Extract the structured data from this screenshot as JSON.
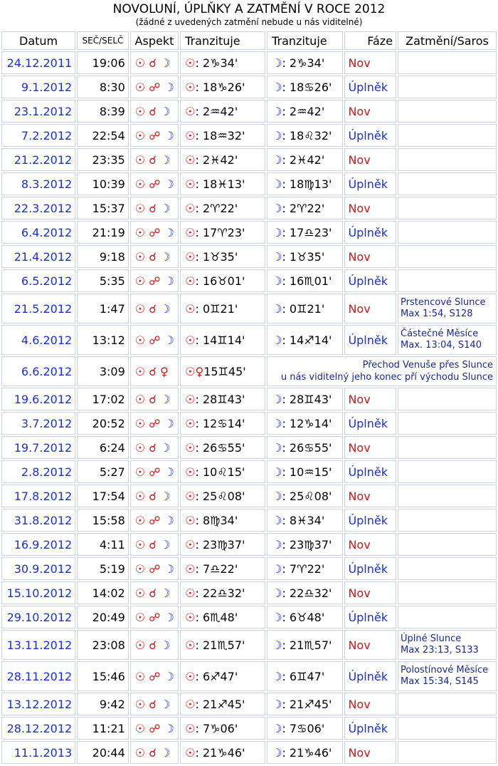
{
  "header": {
    "title": "NOVOLUNÍ, ÚPLŇKY A ZATMĚNÍ V ROCE 2012",
    "subtitle": "(žádné z uvedených zatmění nebude u nás viditelné)"
  },
  "columns": {
    "date": "Datum",
    "time": "SEČ/SELČ",
    "aspect": "Aspekt",
    "transit1": "Tranzituje",
    "transit2": "Tranzituje",
    "phase": "Fáze",
    "eclipse": "Zatmění/Saros"
  },
  "symbols": {
    "sun": "☉",
    "moon": "☽",
    "venus": "♀",
    "conj": "☌",
    "opp": "☍"
  },
  "rows": [
    {
      "date": "24.12.2011",
      "time": "19:06",
      "aspect": "☉ ☌ ☽",
      "sun": "☉: 2♑34'",
      "moon": "☽: 2♑34'",
      "phase": "Nov",
      "eclipse": ""
    },
    {
      "date": "9.1.2012",
      "time": "8:30",
      "aspect": "☉ ☍ ☽",
      "sun": "☉: 18♑26'",
      "moon": "☽: 18♋26'",
      "phase": "Úplněk",
      "eclipse": ""
    },
    {
      "date": "23.1.2012",
      "time": "8:39",
      "aspect": "☉ ☌ ☽",
      "sun": "☉: 2♒42'",
      "moon": "☽: 2♒42'",
      "phase": "Nov",
      "eclipse": ""
    },
    {
      "date": "7.2.2012",
      "time": "22:54",
      "aspect": "☉ ☍ ☽",
      "sun": "☉: 18♒32'",
      "moon": "☽: 18♌32'",
      "phase": "Úplněk",
      "eclipse": ""
    },
    {
      "date": "21.2.2012",
      "time": "23:35",
      "aspect": "☉ ☌ ☽",
      "sun": "☉: 2♓42'",
      "moon": "☽: 2♓42'",
      "phase": "Nov",
      "eclipse": ""
    },
    {
      "date": "8.3.2012",
      "time": "10:39",
      "aspect": "☉ ☍ ☽",
      "sun": "☉: 18♓13'",
      "moon": "☽: 18♍13'",
      "phase": "Úplněk",
      "eclipse": ""
    },
    {
      "date": "22.3.2012",
      "time": "15:37",
      "aspect": "☉ ☌ ☽",
      "sun": "☉: 2♈22'",
      "moon": "☽: 2♈22'",
      "phase": "Nov",
      "eclipse": ""
    },
    {
      "date": "6.4.2012",
      "time": "21:19",
      "aspect": "☉ ☍ ☽",
      "sun": "☉: 17♈23'",
      "moon": "☽: 17♎23'",
      "phase": "Úplněk",
      "eclipse": ""
    },
    {
      "date": "21.4.2012",
      "time": "9:18",
      "aspect": "☉ ☌ ☽",
      "sun": "☉: 1♉35'",
      "moon": "☽: 1♉35'",
      "phase": "Nov",
      "eclipse": ""
    },
    {
      "date": "6.5.2012",
      "time": "5:35",
      "aspect": "☉ ☍ ☽",
      "sun": "☉: 16♉01'",
      "moon": "☽: 16♏01'",
      "phase": "Úplněk",
      "eclipse": ""
    },
    {
      "date": "21.5.2012",
      "time": "1:47",
      "aspect": "☉ ☌ ☽",
      "sun": "☉: 0♊21'",
      "moon": "☽: 0♊21'",
      "phase": "Nov",
      "eclipse_l1": "Prstencové Slunce",
      "eclipse_l2": "Max 1:54, S128"
    },
    {
      "date": "4.6.2012",
      "time": "13:12",
      "aspect": "☉ ☍ ☽",
      "sun": "☉: 14♊14'",
      "moon": "☽: 14♐14'",
      "phase": "Úplněk",
      "eclipse_l1": "Částečné Měsíce",
      "eclipse_l2": "Max. 13:04, S140"
    },
    {
      "date": "6.6.2012",
      "time": "3:09",
      "aspect": "☉ ☌ ♀",
      "sun": "☉♀15♊45'",
      "note_l1": "Přechod Venuše přes Slunce",
      "note_l2": "u nás viditelný jeho konec pří východu Slunce"
    },
    {
      "date": "19.6.2012",
      "time": "17:02",
      "aspect": "☉ ☌ ☽",
      "sun": "☉: 28♊43'",
      "moon": "☽: 28♊43'",
      "phase": "Nov",
      "eclipse": ""
    },
    {
      "date": "3.7.2012",
      "time": "20:52",
      "aspect": "☉ ☍ ☽",
      "sun": "☉: 12♋14'",
      "moon": "☽: 12♑14'",
      "phase": "Úplněk",
      "eclipse": ""
    },
    {
      "date": "19.7.2012",
      "time": "6:24",
      "aspect": "☉ ☌ ☽",
      "sun": "☉: 26♋55'",
      "moon": "☽: 26♋55'",
      "phase": "Nov",
      "eclipse": ""
    },
    {
      "date": "2.8.2012",
      "time": "5:27",
      "aspect": "☉ ☍ ☽",
      "sun": "☉: 10♌15'",
      "moon": "☽: 10♒15'",
      "phase": "Úplněk",
      "eclipse": ""
    },
    {
      "date": "17.8.2012",
      "time": "17:54",
      "aspect": "☉ ☌ ☽",
      "sun": "☉: 25♌08'",
      "moon": "☽: 25♌08'",
      "phase": "Nov",
      "eclipse": ""
    },
    {
      "date": "31.8.2012",
      "time": "15:58",
      "aspect": "☉ ☍ ☽",
      "sun": "☉: 8♍34'",
      "moon": "☽: 8♓34'",
      "phase": "Úplněk",
      "eclipse": ""
    },
    {
      "date": "16.9.2012",
      "time": "4:11",
      "aspect": "☉ ☌ ☽",
      "sun": "☉: 23♍37'",
      "moon": "☽: 23♍37'",
      "phase": "Nov",
      "eclipse": ""
    },
    {
      "date": "30.9.2012",
      "time": "5:19",
      "aspect": "☉ ☍ ☽",
      "sun": "☉: 7♎22'",
      "moon": "☽: 7♈22'",
      "phase": "Úplněk",
      "eclipse": ""
    },
    {
      "date": "15.10.2012",
      "time": "14:02",
      "aspect": "☉ ☌ ☽",
      "sun": "☉: 22♎32'",
      "moon": "☽: 22♎32'",
      "phase": "Nov",
      "eclipse": ""
    },
    {
      "date": "29.10.2012",
      "time": "20:49",
      "aspect": "☉ ☍ ☽",
      "sun": "☉: 6♏48'",
      "moon": "☽: 6♉48'",
      "phase": "Úplněk",
      "eclipse": ""
    },
    {
      "date": "13.11.2012",
      "time": "23:08",
      "aspect": "☉ ☌ ☽",
      "sun": "☉: 21♏57'",
      "moon": "☽: 21♏57'",
      "phase": "Nov",
      "eclipse_l1": "Úplné Slunce",
      "eclipse_l2": "Max 23:13, S133"
    },
    {
      "date": "28.11.2012",
      "time": "15:46",
      "aspect": "☉ ☍ ☽",
      "sun": "☉: 6♐47'",
      "moon": "☽: 6♊47'",
      "phase": "Úplněk",
      "eclipse_l1": "Polostínové Měsíce",
      "eclipse_l2": "Max 15:34, S145"
    },
    {
      "date": "13.12.2012",
      "time": "9:42",
      "aspect": "☉ ☌ ☽",
      "sun": "☉: 21♐45'",
      "moon": "☽: 21♐45'",
      "phase": "Nov",
      "eclipse": ""
    },
    {
      "date": "28.12.2012",
      "time": "11:21",
      "aspect": "☉ ☍ ☽",
      "sun": "☉: 7♑06'",
      "moon": "☽: 7♋06'",
      "phase": "Úplněk",
      "eclipse": ""
    },
    {
      "date": "11.1.2013",
      "time": "20:44",
      "aspect": "☉ ☌ ☽",
      "sun": "☉: 21♑46'",
      "moon": "☽: 21♑46'",
      "phase": "Nov",
      "eclipse": ""
    }
  ],
  "colors": {
    "blue": "#1a2fd8",
    "red": "#d01818",
    "border": "#c9d3e3"
  }
}
